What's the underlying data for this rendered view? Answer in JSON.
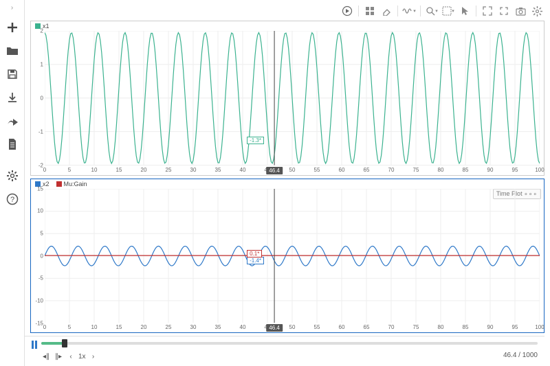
{
  "chart_data": [
    {
      "type": "line",
      "title": "",
      "xlabel": "",
      "ylabel": "",
      "xlim": [
        0,
        100
      ],
      "ylim": [
        -2,
        2
      ],
      "xticks": [
        0,
        5,
        10,
        15,
        20,
        25,
        30,
        35,
        40,
        45,
        50,
        55,
        60,
        65,
        70,
        75,
        80,
        85,
        90,
        95,
        100
      ],
      "yticks": [
        -2,
        -1,
        0,
        1,
        2
      ],
      "series": [
        {
          "name": "x1",
          "color": "#3bb28f",
          "amplitude_start": 1.95,
          "amplitude_end": 1.95,
          "frequency": 0.185,
          "phase": 1.57
        }
      ],
      "cursor": {
        "x": 46.4,
        "values": {
          "x1": -1.3
        },
        "value_suffix": "*"
      }
    },
    {
      "type": "line",
      "title": "",
      "xlabel": "",
      "ylabel": "",
      "xlim": [
        0,
        100
      ],
      "ylim": [
        -15,
        15
      ],
      "xticks": [
        0,
        5,
        10,
        15,
        20,
        25,
        30,
        35,
        40,
        45,
        50,
        55,
        60,
        65,
        70,
        75,
        80,
        85,
        90,
        95,
        100
      ],
      "yticks": [
        -15,
        -10,
        -5,
        0,
        5,
        10,
        15
      ],
      "series": [
        {
          "name": "x2",
          "color": "#2e78c8",
          "amplitude_start": 2.2,
          "amplitude_end": 2.2,
          "frequency": 0.185,
          "phase": 0.0
        },
        {
          "name": "Mu:Gain",
          "color": "#c03030",
          "amplitude_start": 0.1,
          "amplitude_end": 0.1,
          "frequency": 0.0,
          "phase": 0.0,
          "offset": 0.1
        }
      ],
      "cursor": {
        "x": 46.4,
        "values": {
          "x2": -1.4,
          "Mu:Gain": 0.1
        },
        "value_suffix": "*"
      },
      "selected": true,
      "badge": "Time Plot"
    }
  ],
  "playback": {
    "current": 46.4,
    "total": 1000.0,
    "speed": "1x"
  },
  "cursor_x_label": "46.4",
  "left_chevron": "›"
}
